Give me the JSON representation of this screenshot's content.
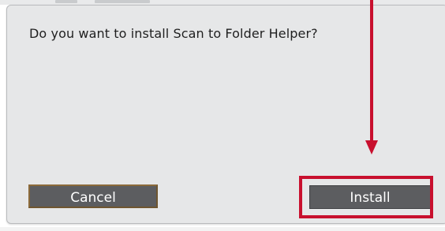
{
  "dialog": {
    "message": "Do you want to install Scan to Folder Helper?",
    "cancel_label": "Cancel",
    "install_label": "Install"
  },
  "annotation": {
    "color": "#c8102e"
  },
  "colors": {
    "dialog_background": "#e6e7e8",
    "button_background": "#5c5d60",
    "button_text": "#ffffff"
  }
}
